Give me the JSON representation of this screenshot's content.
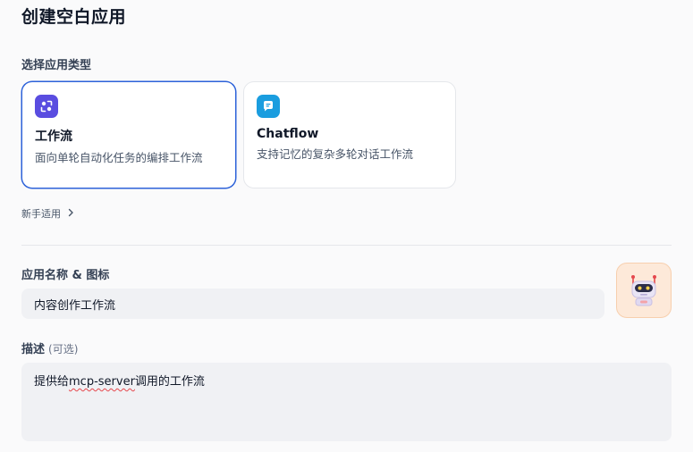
{
  "header": {
    "title": "创建空白应用"
  },
  "app_type": {
    "label": "选择应用类型",
    "cards": [
      {
        "title": "工作流",
        "desc": "面向单轮自动化任务的编排工作流",
        "icon": "workflow-icon",
        "selected": true
      },
      {
        "title": "Chatflow",
        "desc": "支持记忆的复杂多轮对话工作流",
        "icon": "chatflow-icon",
        "selected": false
      }
    ],
    "beginner_link": "新手适用"
  },
  "name_section": {
    "label": "应用名称 & 图标",
    "value": "内容创作工作流",
    "app_icon": "robot-icon"
  },
  "desc_section": {
    "label": "描述",
    "optional": "(可选)",
    "value_prefix": "提供给",
    "value_underlined": "mcp-server",
    "value_suffix": "调用的工作流"
  },
  "colors": {
    "selected_border": "#2d62d9",
    "workflow_icon_bg": "#5a4de0",
    "chatflow_icon_bg": "#1a9ddf",
    "app_icon_bg": "#fde9d9"
  }
}
